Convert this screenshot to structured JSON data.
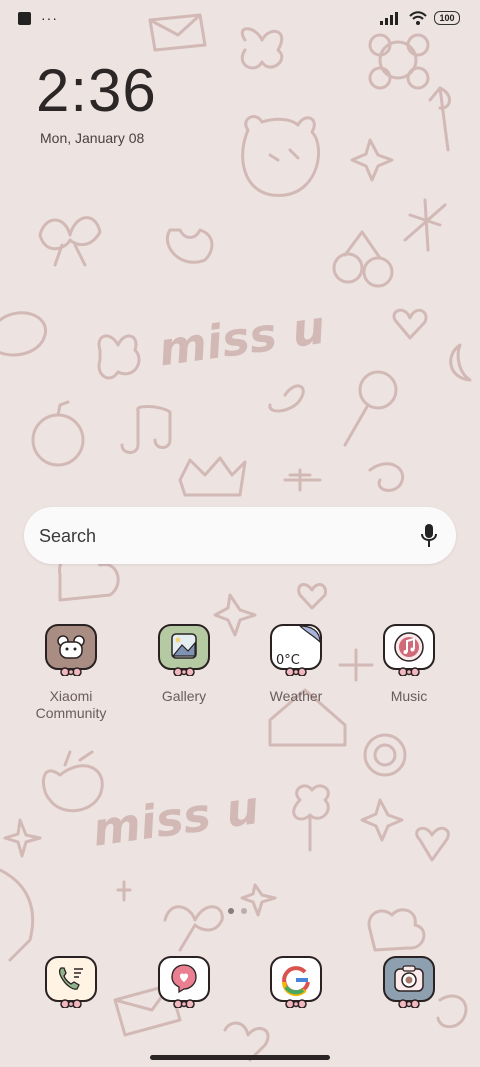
{
  "status_bar": {
    "notification_icons": [
      "app-square-icon",
      "more-dots-icon"
    ],
    "more_text": "···",
    "system_icons": [
      "signal-icon",
      "wifi-icon",
      "battery-icon"
    ],
    "battery_level": "100"
  },
  "clock": {
    "time": "2:36",
    "date": "Mon, January 08"
  },
  "search": {
    "placeholder": "Search",
    "icon": "microphone-icon"
  },
  "home_apps": [
    {
      "label": "Xiaomi Community",
      "icon": "bear-icon",
      "color": "#a98d83"
    },
    {
      "label": "Gallery",
      "icon": "image-icon",
      "color": "#b5c9a3"
    },
    {
      "label": "Weather",
      "icon": "weather-icon",
      "color": "#ffffff",
      "temp": "0°C"
    },
    {
      "label": "Music",
      "icon": "music-note-icon",
      "color": "#ffffff"
    }
  ],
  "page_indicator": {
    "pages": 2,
    "current": 1
  },
  "dock": [
    {
      "icon": "phone-icon",
      "color": "#fff3e3"
    },
    {
      "icon": "message-icon",
      "color": "#ffffff"
    },
    {
      "icon": "google-icon",
      "color": "#ffffff"
    },
    {
      "icon": "camera-icon",
      "color": "#8ea0b0"
    }
  ],
  "wallpaper": {
    "text": "miss u",
    "background": "#ede3e0",
    "ink": "#c9aeac"
  }
}
